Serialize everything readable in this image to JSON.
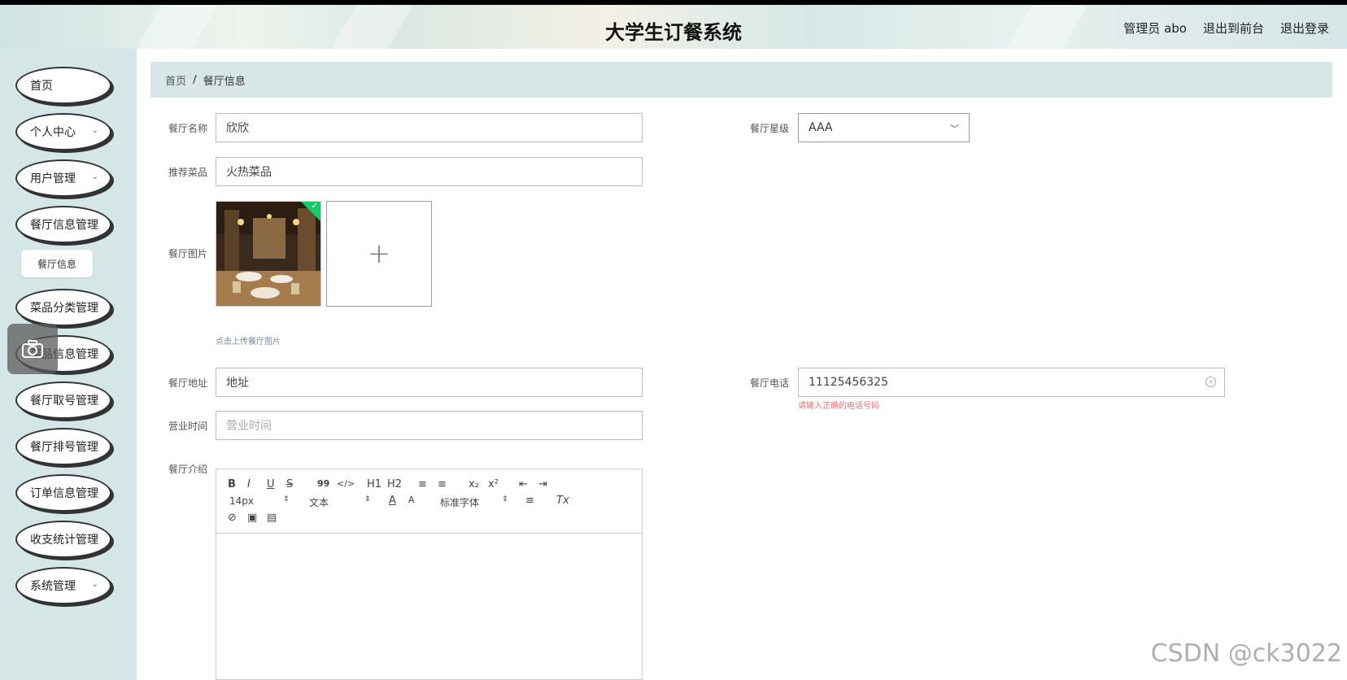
{
  "header": {
    "title": "大学生订餐系统",
    "admin_label": "管理员 abo",
    "front_label": "退出到前台",
    "logout_label": "退出登录"
  },
  "sidebar": {
    "items": [
      {
        "label": "首页",
        "has_chevron": false
      },
      {
        "label": "个人中心",
        "has_chevron": true
      },
      {
        "label": "用户管理",
        "has_chevron": true
      },
      {
        "label": "餐厅信息管理",
        "has_chevron": false
      },
      {
        "label": "菜品分类管理",
        "has_chevron": false
      },
      {
        "label": "菜品信息管理",
        "has_chevron": false
      },
      {
        "label": "餐厅取号管理",
        "has_chevron": false
      },
      {
        "label": "餐厅排号管理",
        "has_chevron": false
      },
      {
        "label": "订单信息管理",
        "has_chevron": false
      },
      {
        "label": "收支统计管理",
        "has_chevron": false
      },
      {
        "label": "系统管理",
        "has_chevron": true
      }
    ],
    "sub_item": "餐厅信息"
  },
  "breadcrumb": {
    "home": "首页",
    "separator": "/",
    "current": "餐厅信息"
  },
  "form": {
    "name_label": "餐厅名称",
    "name_value": "欣欣",
    "star_label": "餐厅星级",
    "star_value": "AAA",
    "dish_label": "推荐菜品",
    "dish_value": "火热菜品",
    "image_label": "餐厅图片",
    "upload_plus": "+",
    "upload_tip": "点击上传餐厅图片",
    "address_label": "餐厅地址",
    "address_value": "地址",
    "phone_label": "餐厅电话",
    "phone_value": "11125456325",
    "phone_error": "请输入正确的电话号码",
    "hours_label": "营业时间",
    "hours_placeholder": "营业时间",
    "intro_label": "餐厅介绍"
  },
  "editor": {
    "bold": "B",
    "italic": "I",
    "underline": "U",
    "strike": "S",
    "quote": "99",
    "code": "</>",
    "h1": "H1",
    "h2": "H2",
    "ordered_list": "≡",
    "bullet_list": "≡",
    "subscript": "x₂",
    "superscript": "x²",
    "indent_out": "⇤",
    "indent_in": "⇥",
    "size_select": "14px",
    "type_select": "文本",
    "font_color": "A",
    "background": "A",
    "font_select": "标准字体",
    "align": "≡",
    "clear_format": "Tx",
    "link": "⊘",
    "image": "▣",
    "video": "▤"
  },
  "watermark": "CSDN @ck3022",
  "colors": {
    "sidebar_bg": "#d4e6e6",
    "breadcrumb_bg": "#d8e6e8",
    "error": "#f56c6c",
    "success": "#13ce66"
  }
}
